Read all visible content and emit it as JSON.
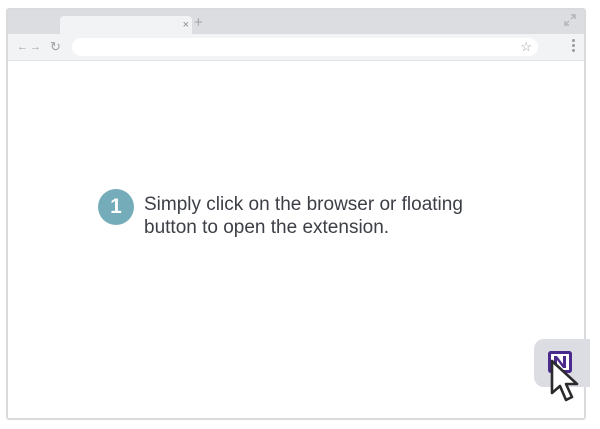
{
  "browser": {
    "tab_close_glyph": "×",
    "new_tab_glyph": "+",
    "back_glyph": "←",
    "forward_glyph": "→",
    "reload_glyph": "↻",
    "star_glyph": "☆"
  },
  "step": {
    "number": "1",
    "text": "Simply click on the browser or floating button to open the extension."
  },
  "colors": {
    "step_badge": "#74adb9",
    "logo": "#4a2a8c",
    "text": "#3c3f46"
  },
  "icons": [
    "resize-icon",
    "menu-icon",
    "extension-logo-icon",
    "cursor-pointer-icon"
  ]
}
